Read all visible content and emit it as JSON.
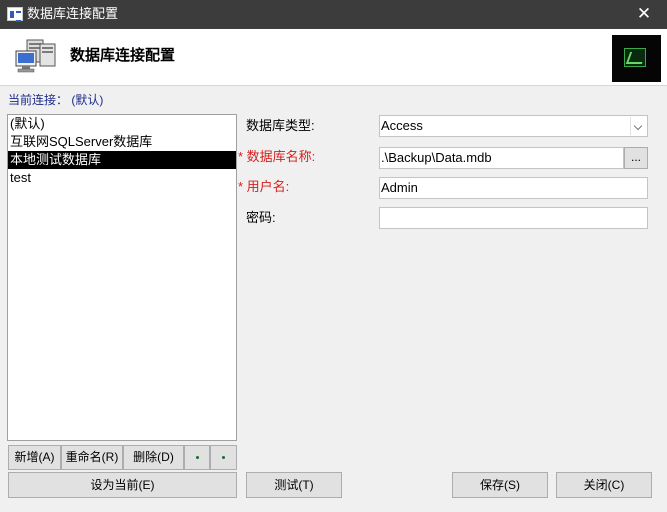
{
  "window": {
    "title": "数据库连接配置",
    "close_glyph": "✕"
  },
  "header": {
    "title": "数据库连接配置"
  },
  "current_connection": "当前连接： (默认)",
  "connections": [
    "(默认)",
    "互联网SQLServer数据库",
    "本地测试数据库",
    "test"
  ],
  "selected_index": 2,
  "list_buttons": {
    "add": "新增(A)",
    "rename": "重命名(R)",
    "delete": "删除(D)"
  },
  "set_current_button": "设为当前(E)",
  "form": {
    "db_type_label": "数据库类型:",
    "db_type_value": "Access",
    "db_name_label": "* 数据库名称:",
    "db_name_value": ".\\Backup\\Data.mdb",
    "browse_label": "...",
    "user_label": "* 用户名:",
    "user_value": "Admin",
    "password_label": "密码:",
    "password_value": ""
  },
  "buttons": {
    "test": "测试(T)",
    "save": "保存(S)",
    "close": "关闭(C)"
  },
  "colors": {
    "title_bar": "#3c3c3c",
    "required_label": "#d42020",
    "current_connection": "#1c2c8c",
    "selected_item": "#000000"
  }
}
